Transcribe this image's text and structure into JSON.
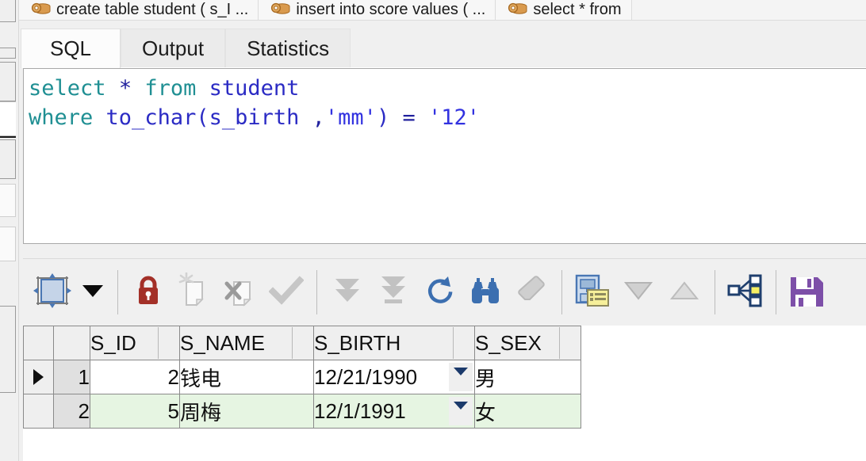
{
  "window_tabs": [
    {
      "label": "create table student ( s_I ...",
      "icon": "database-icon"
    },
    {
      "label": "insert into score values ( ...",
      "icon": "database-icon"
    },
    {
      "label": "select * from",
      "icon": "database-icon"
    }
  ],
  "editor_tabs": [
    {
      "label": "SQL",
      "active": true
    },
    {
      "label": "Output",
      "active": false
    },
    {
      "label": "Statistics",
      "active": false
    }
  ],
  "sql": {
    "line1": [
      {
        "t": "select",
        "c": "kw"
      },
      {
        "t": " ",
        "c": "plain"
      },
      {
        "t": "*",
        "c": "op"
      },
      {
        "t": " ",
        "c": "plain"
      },
      {
        "t": "from",
        "c": "kw"
      },
      {
        "t": " ",
        "c": "plain"
      },
      {
        "t": "student",
        "c": "ident"
      }
    ],
    "line2": [
      {
        "t": "where",
        "c": "kw"
      },
      {
        "t": " ",
        "c": "plain"
      },
      {
        "t": "to_char(s_birth ",
        "c": "ident"
      },
      {
        "t": ",",
        "c": "op"
      },
      {
        "t": "'mm'",
        "c": "str"
      },
      {
        "t": ")",
        "c": "ident"
      },
      {
        "t": " ",
        "c": "plain"
      },
      {
        "t": "=",
        "c": "op"
      },
      {
        "t": " ",
        "c": "plain"
      },
      {
        "t": "'12'",
        "c": "str"
      }
    ],
    "full_text": "select * from student\nwhere to_char(s_birth ,'mm') = '12'"
  },
  "toolbar": {
    "buttons": [
      {
        "name": "fit-columns-button",
        "icon": "resize-grid-icon",
        "enabled": true
      },
      {
        "name": "grid-options-dropdown",
        "icon": "chevron-down-icon",
        "enabled": true
      },
      {
        "name": "lock-record-button",
        "icon": "red-lock-icon",
        "enabled": true
      },
      {
        "name": "insert-record-button",
        "icon": "new-record-icon",
        "enabled": false
      },
      {
        "name": "delete-record-button",
        "icon": "delete-record-icon",
        "enabled": false
      },
      {
        "name": "post-changes-button",
        "icon": "checkmark-icon",
        "enabled": false
      },
      {
        "name": "fetch-next-page-button",
        "icon": "double-down-arrow-icon",
        "enabled": false
      },
      {
        "name": "fetch-last-page-button",
        "icon": "down-arrow-to-bar-icon",
        "enabled": false
      },
      {
        "name": "refresh-button",
        "icon": "refresh-circle-icon",
        "enabled": true
      },
      {
        "name": "find-button",
        "icon": "binoculars-icon",
        "enabled": true
      },
      {
        "name": "clear-filter-button",
        "icon": "eraser-icon",
        "enabled": false
      },
      {
        "name": "record-details-button",
        "icon": "record-details-icon",
        "enabled": true
      },
      {
        "name": "sort-descending-button",
        "icon": "triangle-down-icon",
        "enabled": false
      },
      {
        "name": "sort-ascending-button",
        "icon": "triangle-up-icon",
        "enabled": false
      },
      {
        "name": "data-model-button",
        "icon": "hierarchy-icon",
        "enabled": true
      },
      {
        "name": "export-data-button",
        "icon": "purple-floppy-icon",
        "enabled": true
      }
    ]
  },
  "grid": {
    "columns": [
      "S_ID",
      "S_NAME",
      "S_BIRTH",
      "S_SEX"
    ],
    "rows": [
      {
        "num": "1",
        "current": true,
        "S_ID": "2",
        "S_NAME": "钱电",
        "S_BIRTH": "12/21/1990",
        "S_SEX": "男"
      },
      {
        "num": "2",
        "current": false,
        "S_ID": "5",
        "S_NAME": "周梅",
        "S_BIRTH": "12/1/1991",
        "S_SEX": "女"
      }
    ],
    "row_marker_glyph": "▶"
  },
  "colors": {
    "keyword": "#1f8f93",
    "identifier": "#2b2bc4",
    "string": "#3232e0",
    "alt_row": "#e6f5e2",
    "lock_red": "#a33028",
    "accent_blue": "#4a77b4",
    "accent_purple": "#7d4fa8",
    "toolbar_bg": "#f0f0f0"
  }
}
